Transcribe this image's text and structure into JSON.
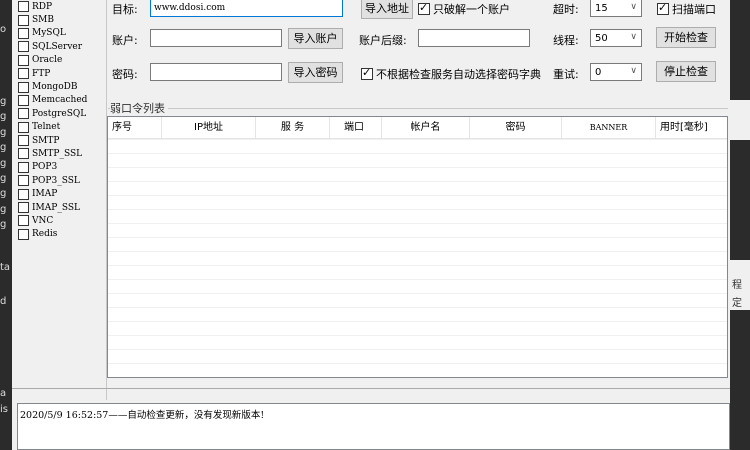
{
  "protocols": [
    {
      "label": "RDP",
      "checked": false
    },
    {
      "label": "SMB",
      "checked": false
    },
    {
      "label": "MySQL",
      "checked": false
    },
    {
      "label": "SQLServer",
      "checked": false
    },
    {
      "label": "Oracle",
      "checked": false
    },
    {
      "label": "FTP",
      "checked": false
    },
    {
      "label": "MongoDB",
      "checked": false
    },
    {
      "label": "Memcached",
      "checked": false
    },
    {
      "label": "PostgreSQL",
      "checked": false
    },
    {
      "label": "Telnet",
      "checked": false
    },
    {
      "label": "SMTP",
      "checked": false
    },
    {
      "label": "SMTP_SSL",
      "checked": false
    },
    {
      "label": "POP3",
      "checked": false
    },
    {
      "label": "POP3_SSL",
      "checked": false
    },
    {
      "label": "IMAP",
      "checked": false
    },
    {
      "label": "IMAP_SSL",
      "checked": false
    },
    {
      "label": "VNC",
      "checked": false
    },
    {
      "label": "Redis",
      "checked": false
    }
  ],
  "form": {
    "target_label": "目标:",
    "target_value": "www.ddosi.com",
    "import_address": "导入地址",
    "crack_one_label": "只破解一个账户",
    "timeout_label": "超时:",
    "timeout_value": "15",
    "scan_port_label": "扫描端口",
    "account_label": "账户:",
    "account_value": "",
    "import_account": "导入账户",
    "account_suffix_label": "账户后缀:",
    "account_suffix_value": "",
    "threads_label": "线程:",
    "threads_value": "50",
    "start_button": "开始检查",
    "password_label": "密码:",
    "password_value": "",
    "import_password": "导入密码",
    "auto_dict_label": "不根据检查服务自动选择密码字典",
    "retry_label": "重试:",
    "retry_value": "0",
    "stop_button": "停止检查"
  },
  "results": {
    "title": "弱口令列表",
    "columns": [
      "序号",
      "IP地址",
      "服 务",
      "端口",
      "帐户名",
      "密码",
      "BANNER",
      "用时[毫秒]"
    ]
  },
  "log": {
    "text": "2020/5/9 16:52:57——自动检查更新，没有发现新版本!"
  },
  "background": {
    "left_fragments": [
      "o",
      "g",
      "g",
      "g",
      "g",
      "g",
      "g",
      "g",
      "g",
      "g",
      "ta",
      "d",
      "a",
      "is"
    ],
    "right_fragments": [
      "程",
      "定"
    ]
  }
}
